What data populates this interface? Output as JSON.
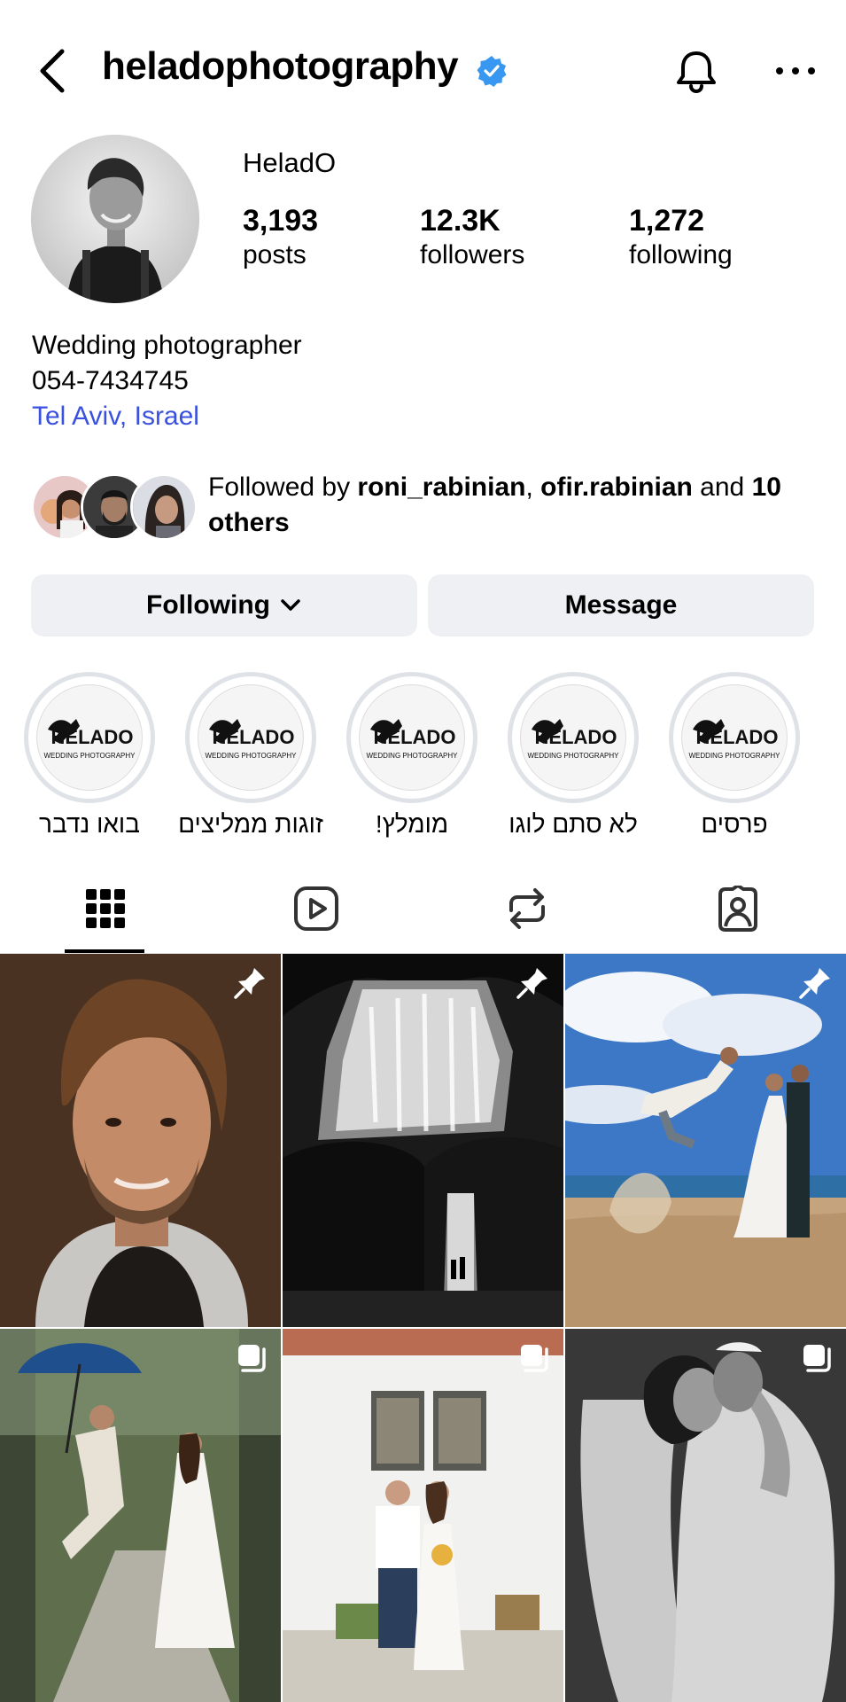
{
  "header": {
    "username": "heladophotography",
    "verified_icon": "verified-badge-icon",
    "accent_color": "#3897f0"
  },
  "profile": {
    "full_name": "HeladO",
    "stats": [
      {
        "value": "3,193",
        "label": "posts"
      },
      {
        "value": "12.3K",
        "label": "followers"
      },
      {
        "value": "1,272",
        "label": "following"
      }
    ],
    "bio": {
      "line1": "Wedding photographer",
      "line2": "054-7434745",
      "location": "Tel Aviv, Israel",
      "location_color": "#3a51e0"
    }
  },
  "followed_by": {
    "prefix": "Followed by ",
    "user1": "roni_rabinian",
    "sep": ", ",
    "user2": "ofir.rabinian",
    "and": " and ",
    "count": "10",
    "suffix": "others"
  },
  "actions": {
    "following_label": "Following",
    "message_label": "Message",
    "button_bg": "#eef0f3"
  },
  "highlights": [
    {
      "label": "בואו נדבר",
      "logo": "HELADO",
      "sub": "WEDDING PHOTOGRAPHY"
    },
    {
      "label": "זוגות ממליצים",
      "logo": "HELADO",
      "sub": "WEDDING PHOTOGRAPHY"
    },
    {
      "label": "מומלץ!",
      "logo": "HELADO",
      "sub": "WEDDING PHOTOGRAPHY"
    },
    {
      "label": "לא סתם לוגו",
      "logo": "HELADO",
      "sub": "WEDDING PHOTOGRAPHY"
    },
    {
      "label": "פרסים",
      "logo": "HELADO",
      "sub": "WEDDING PHOTOGRAPHY"
    }
  ],
  "tabs": [
    {
      "icon": "grid-icon",
      "active": true
    },
    {
      "icon": "reels-icon",
      "active": false
    },
    {
      "icon": "reposts-icon",
      "active": false
    },
    {
      "icon": "tagged-icon",
      "active": false
    }
  ],
  "posts": [
    {
      "kind": "portrait",
      "badge": "pin-icon"
    },
    {
      "kind": "waterfall",
      "badge": "pin-icon"
    },
    {
      "kind": "beach-jump",
      "badge": "pin-icon"
    },
    {
      "kind": "umbrella-jump",
      "badge": "carousel-icon"
    },
    {
      "kind": "couple-house",
      "badge": "carousel-icon"
    },
    {
      "kind": "embrace-bw",
      "badge": "carousel-icon"
    }
  ]
}
